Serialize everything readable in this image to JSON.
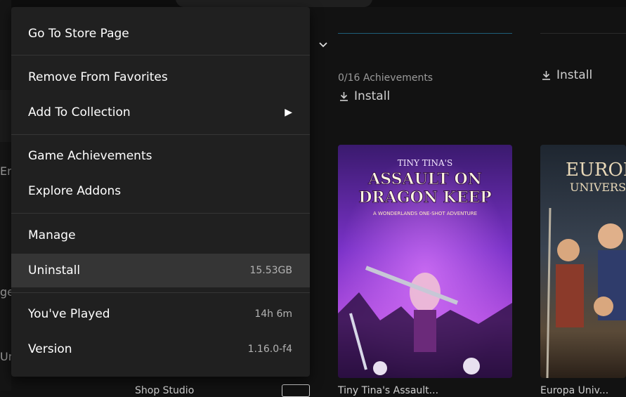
{
  "menu": {
    "items": [
      {
        "label": "Go To Store Page",
        "value": ""
      },
      {
        "label": "Remove From Favorites",
        "value": ""
      },
      {
        "label": "Add To Collection",
        "value": ""
      },
      {
        "label": "Game Achievements",
        "value": ""
      },
      {
        "label": "Explore Addons",
        "value": ""
      },
      {
        "label": "Manage",
        "value": ""
      },
      {
        "label": "Uninstall",
        "value": "15.53GB"
      },
      {
        "label": "You've Played",
        "value": "14h 6m"
      },
      {
        "label": "Version",
        "value": "1.16.0-f4"
      }
    ],
    "submenu_arrow": "▶"
  },
  "library": {
    "card1": {
      "achievements": "0/16 Achievements",
      "install_label": "Install",
      "art_title_line1": "TINY TINA'S",
      "art_title_line2": "ASSAULT ON",
      "art_title_line3": "DRAGON KEEP",
      "art_subtitle": "A WONDERLANDS ONE-SHOT ADVENTURE",
      "bottom_title": "Tiny Tina's Assault..."
    },
    "card2": {
      "install_label": "Install",
      "art_title_line1": "EUROPA",
      "art_title_line2": "UNIVERSALIS",
      "bottom_title": "Europa Univ..."
    },
    "left_clipped": {
      "line1": "Eng",
      "line2": "ge",
      "line3": "Uni"
    },
    "bottom_left_text": "Shop Studio"
  },
  "icons": {
    "install": "download-icon",
    "chevron": "chevron-down-icon",
    "submenu": "chevron-right-icon"
  },
  "colors": {
    "menu_bg": "#202020",
    "menu_hover": "#353535",
    "page_bg": "#121212",
    "accent_line": "#1e5f7a"
  }
}
